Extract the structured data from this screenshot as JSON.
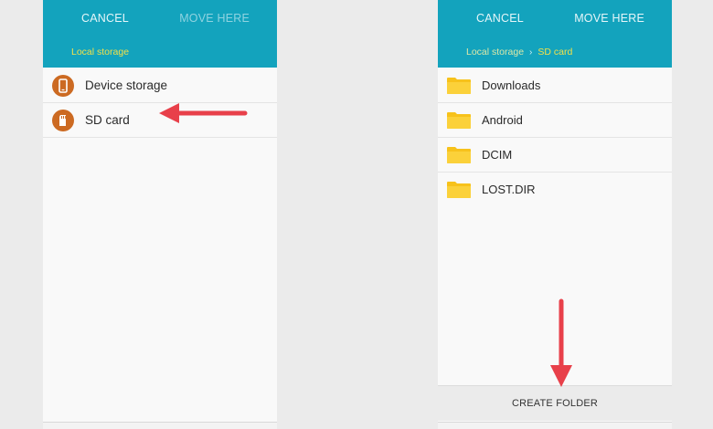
{
  "left": {
    "header": {
      "cancel_label": "CANCEL",
      "move_label": "MOVE HERE"
    },
    "breadcrumb": [
      "Local storage"
    ],
    "items": [
      {
        "label": "Device storage",
        "icon": "phone-icon"
      },
      {
        "label": "SD card",
        "icon": "sd-card-icon"
      }
    ]
  },
  "right": {
    "header": {
      "cancel_label": "CANCEL",
      "move_label": "MOVE HERE"
    },
    "breadcrumb": [
      "Local storage",
      "SD card"
    ],
    "folders": [
      {
        "label": "Downloads"
      },
      {
        "label": "Android"
      },
      {
        "label": "DCIM"
      },
      {
        "label": "LOST.DIR"
      }
    ],
    "create_folder_label": "CREATE FOLDER"
  },
  "colors": {
    "header": "#13a3bd",
    "storage_icon": "#cc6a22",
    "folder": "#f7c21b",
    "annotation_arrow": "#e8404a"
  }
}
